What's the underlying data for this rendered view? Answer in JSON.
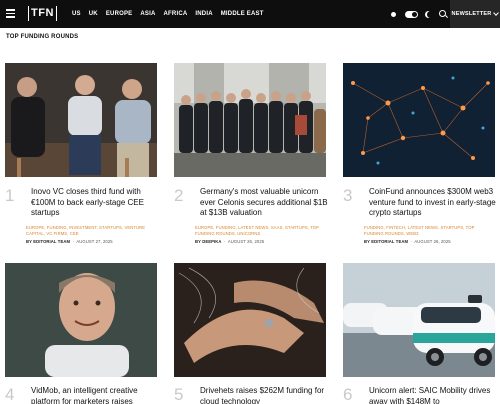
{
  "nav": {
    "logo": "TFN",
    "links": [
      "US",
      "UK",
      "EUROPE",
      "ASIA",
      "AFRICA",
      "INDIA",
      "MIDDLE EAST"
    ],
    "newsletter_label": "NEWSLETTER"
  },
  "section_title": "TOP FUNDING ROUNDS",
  "cards": [
    {
      "number": "1",
      "title": "Inovo VC closes third fund with €100M to back early-stage CEE startups",
      "tags": "EUROPE, FUNDING, INVESTMENT, STARTUPS, VENTURE CAPITAL, VC FIRMS, CEE",
      "author": "BY EDITORIAL TEAM",
      "date": "AUGUST 27, 2025"
    },
    {
      "number": "2",
      "title": "Germany's most valuable unicorn ever Celonis secures additional $1B at $13B valuation",
      "tags": "EUROPE, FUNDING, LATEST NEWS, SAAS, STARTUPS, TOP FUNDING ROUNDS, UNICORNS",
      "author": "BY DEEPIKA",
      "date": "AUGUST 26, 2025"
    },
    {
      "number": "3",
      "title": "CoinFund announces $300M web3 venture fund to invest in early-stage crypto startups",
      "tags": "FUNDING, FINTECH, LATEST NEWS, STARTUPS, TOP FUNDING ROUNDS, WEB3",
      "author": "BY EDITORIAL TEAM",
      "date": "AUGUST 26, 2025"
    },
    {
      "number": "4",
      "title": "VidMob, an intelligent creative platform for marketers raises",
      "tags": "",
      "author": "",
      "date": ""
    },
    {
      "number": "5",
      "title": "Drivehets raises $262M funding for cloud technology",
      "tags": "",
      "author": "",
      "date": ""
    },
    {
      "number": "6",
      "title": "Unicorn alert: SAIC Mobility drives away with $148M to",
      "tags": "",
      "author": "",
      "date": ""
    }
  ]
}
